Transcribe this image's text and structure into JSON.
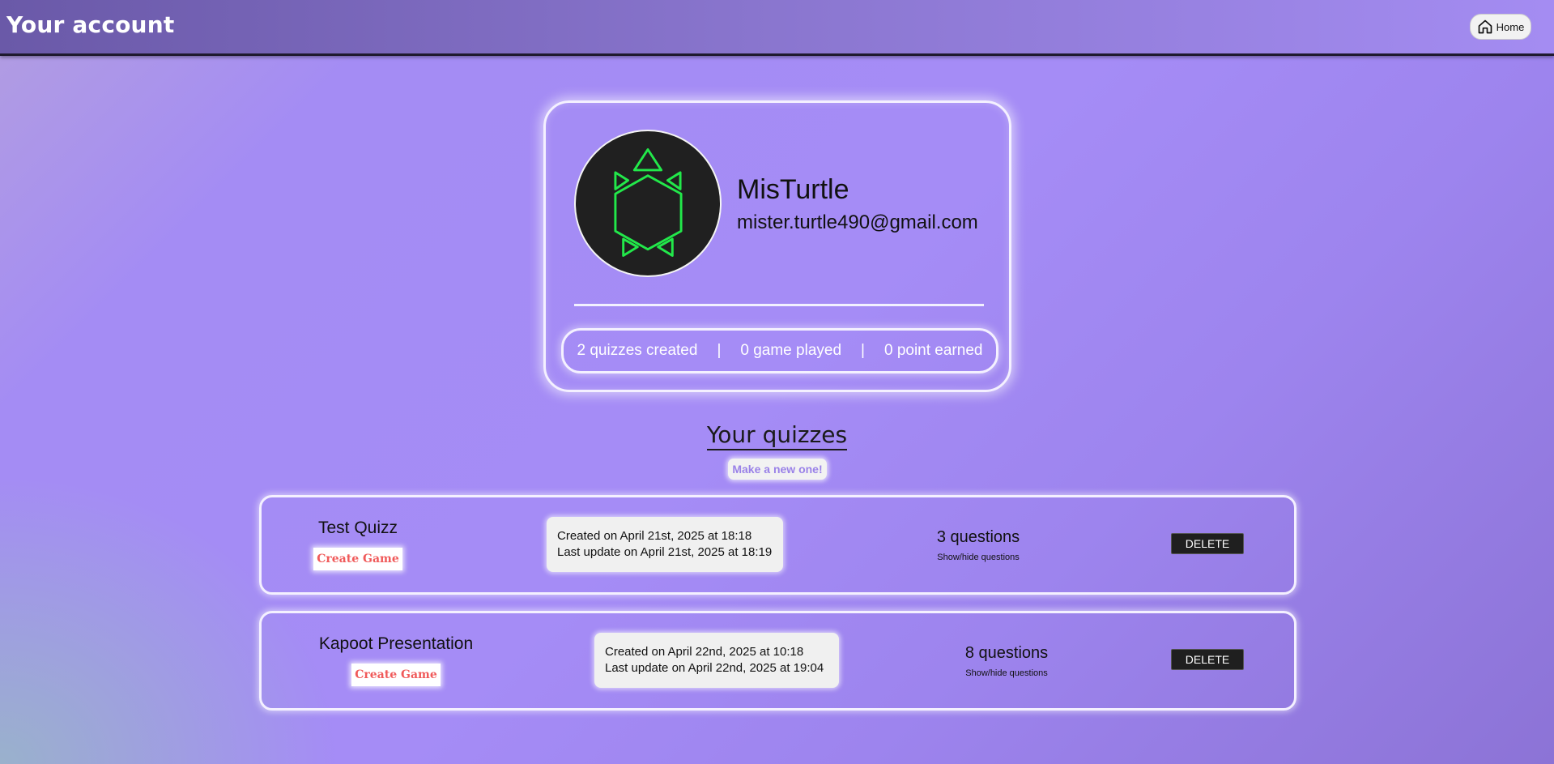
{
  "header": {
    "title": "Your account",
    "home_label": "Home",
    "home_icon": "home-icon"
  },
  "profile": {
    "avatar_icon": "turtle-icon",
    "avatar_colors": {
      "background": "#202020",
      "stroke": "#22e84a"
    },
    "username": "MisTurtle",
    "email": "mister.turtle490@gmail.com",
    "stats": {
      "quizzes": "2 quizzes created",
      "separator": "|",
      "games": "0 game played",
      "points": "0 point earned"
    }
  },
  "quizzes_section": {
    "title": "Your quizzes",
    "new_label": "Make a new one!"
  },
  "quizzes": [
    {
      "name": "Test Quizz",
      "create_label": "Create Game",
      "created": "Created on April 21st, 2025 at 18:18",
      "updated": "Last update on April 21st, 2025 at 18:19",
      "questions": "3 questions",
      "toggle_label": "Show/hide questions",
      "delete_label": "DELETE"
    },
    {
      "name": "Kapoot Presentation",
      "create_label": "Create Game",
      "created": "Created on April 22nd, 2025 at 10:18",
      "updated": "Last update on April 22nd, 2025 at 19:04",
      "questions": "8 questions",
      "toggle_label": "Show/hide questions",
      "delete_label": "DELETE"
    }
  ],
  "colors": {
    "accent": "#a58cf6",
    "create_game_text": "#f05a5a",
    "new_button_text": "#9a82e8"
  }
}
